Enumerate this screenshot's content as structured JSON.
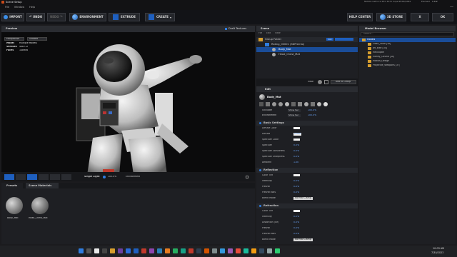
{
  "window": {
    "title": "Scene Setup",
    "menus": [
      "File",
      "Window",
      "Help"
    ],
    "system_info": "NVIDIA GeForce RTX 3070 SuperPCD6/SSE2",
    "element_label": "Element",
    "element_value": "1.0.2"
  },
  "toolbar": {
    "import": "IMPORT",
    "undo": "UNDO",
    "redo": "REDO",
    "environment": "ENVIRONMENT",
    "extrude": "EXTRUDE",
    "create": "CREATE",
    "help_center": "HELP CENTER",
    "store": "3D STORE",
    "close": "X",
    "ok": "OK"
  },
  "preview": {
    "title": "Preview",
    "draft_textures": "Draft Textures",
    "camera": "Perspective",
    "shading": "Shaded",
    "info": [
      {
        "label": "Model",
        "value": "Multiple Models"
      },
      {
        "label": "Vertices",
        "value": "448712"
      },
      {
        "label": "Faces",
        "value": "148906"
      }
    ],
    "light": "Single Light",
    "light_value": "100.0%",
    "environment": "Environment"
  },
  "scene": {
    "title": "Scene",
    "menus": [
      "File",
      "Edit",
      "View"
    ],
    "tree": [
      {
        "label": "Group Folder",
        "level": 0,
        "type": "folder",
        "badge": "0.0"
      },
      {
        "label": "Rating_00001 (3DPremio)",
        "level": 1,
        "type": "mesh"
      },
      {
        "label": "Body_Mat",
        "level": 2,
        "type": "mat",
        "selected": true
      },
      {
        "label": "Head_Chest_Mat",
        "level": 2,
        "type": "mat"
      }
    ],
    "view_label": "View:",
    "add_to_group": "Add to Group"
  },
  "edit": {
    "title": "Edit",
    "material_name": "Body_Mat",
    "occlusion": {
      "label": "Occluder",
      "btn": "Show Sel",
      "value": "100.0%"
    },
    "environment": {
      "label": "Environment",
      "btn": "Show Sel",
      "value": "100.0%"
    },
    "sections": [
      {
        "title": "Basic Settings",
        "rows": [
          {
            "label": "Diffuse Color",
            "type": "swatch"
          },
          {
            "label": "Diffuse",
            "value": "0.000",
            "type": "active"
          },
          {
            "label": "Specular Color",
            "type": "swatch"
          },
          {
            "label": "Specular",
            "value": "0.0%"
          },
          {
            "label": "Specular Glossiness",
            "value": "0.0%"
          },
          {
            "label": "Specular Sharpness",
            "value": "0.0%"
          },
          {
            "label": "Ambient",
            "value": "1.00"
          }
        ]
      },
      {
        "title": "Reflection",
        "rows": [
          {
            "label": "Color Tint",
            "type": "swatch"
          },
          {
            "label": "Intensity",
            "value": "0.0%"
          },
          {
            "label": "Fresnel",
            "value": "0.0%"
          },
          {
            "label": "Fresnel Bias",
            "value": "0.0%"
          },
          {
            "label": "Blend Mode",
            "value": "Normal Clamp",
            "type": "select"
          }
        ]
      },
      {
        "title": "Refraction",
        "rows": [
          {
            "label": "Color Tint",
            "type": "swatch"
          },
          {
            "label": "Intensity",
            "value": "0.0%"
          },
          {
            "label": "Distortion (ior)",
            "value": "0.0%"
          },
          {
            "label": "Fresnel",
            "value": "0.0%"
          },
          {
            "label": "Fresnel Bias",
            "value": "0.0%"
          },
          {
            "label": "Blend Mode",
            "value": "Normal Clamp",
            "type": "select"
          }
        ]
      }
    ]
  },
  "browser": {
    "title": "Model Browser",
    "search_placeholder": "Search...",
    "items": [
      {
        "label": "Models",
        "level": 0,
        "selected": true
      },
      {
        "label": "Fresh_Food [18]",
        "level": 1
      },
      {
        "label": "Jet_Bike [34]",
        "level": 1
      },
      {
        "label": "Helicopter",
        "level": 1
      },
      {
        "label": "Money_Casino [18]",
        "level": 1
      },
      {
        "label": "Motion_Design",
        "level": 1
      },
      {
        "label": "Projectile_Weapons [37]",
        "level": 1
      }
    ]
  },
  "bottom": {
    "tabs": [
      "Presets",
      "Scene Materials"
    ],
    "materials": [
      "Body_Mat",
      "Head_Chest_Mat"
    ]
  },
  "taskbar": {
    "time": "10:03 AM",
    "date": "7/30/2023"
  },
  "colors": {
    "accent": "#1e5fbf",
    "accent_light": "#2f7de0",
    "selection": "#1a4d99",
    "panel": "#1e1f23",
    "header": "#2a2c31",
    "orange": "#e07a1c"
  }
}
